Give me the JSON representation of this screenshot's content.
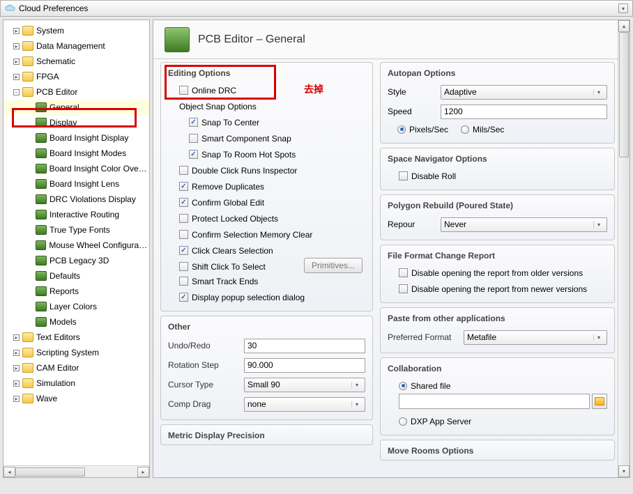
{
  "window": {
    "title": "Cloud Preferences"
  },
  "tree": {
    "top": [
      {
        "label": "System",
        "type": "fold"
      },
      {
        "label": "Data Management",
        "type": "fold"
      },
      {
        "label": "Schematic",
        "type": "fold"
      },
      {
        "label": "FPGA",
        "type": "fold"
      }
    ],
    "pcb_label": "PCB Editor",
    "pcb_children": [
      "General",
      "Display",
      "Board Insight Display",
      "Board Insight Modes",
      "Board Insight Color Overrid",
      "Board Insight Lens",
      "DRC Violations Display",
      "Interactive Routing",
      "True Type Fonts",
      "Mouse Wheel Configuration",
      "PCB Legacy 3D",
      "Defaults",
      "Reports",
      "Layer Colors",
      "Models"
    ],
    "bottom": [
      "Text Editors",
      "Scripting System",
      "CAM Editor",
      "Simulation",
      "Wave"
    ]
  },
  "page": {
    "title": "PCB Editor – General"
  },
  "annotation": "去掉",
  "editing": {
    "heading": "Editing Options",
    "online_drc": "Online DRC",
    "osnap_head": "Object Snap Options",
    "snap_center": "Snap To Center",
    "smart_snap": "Smart Component Snap",
    "snap_room": "Snap To Room Hot Spots",
    "dbl_click": "Double Click Runs Inspector",
    "rem_dup": "Remove Duplicates",
    "conf_global": "Confirm Global Edit",
    "protect_lock": "Protect Locked Objects",
    "conf_mem": "Confirm Selection Memory Clear",
    "click_clears": "Click Clears Selection",
    "shift_click": "Shift Click To Select",
    "smart_track": "Smart Track Ends",
    "popup_sel": "Display popup selection dialog",
    "primitives_btn": "Primitives..."
  },
  "other": {
    "heading": "Other",
    "undo_label": "Undo/Redo",
    "undo": "30",
    "rot_label": "Rotation Step",
    "rot": "90.000",
    "cursor_label": "Cursor Type",
    "cursor": "Small 90",
    "drag_label": "Comp Drag",
    "drag": "none"
  },
  "metric": {
    "heading": "Metric Display Precision"
  },
  "autopan": {
    "heading": "Autopan Options",
    "style_label": "Style",
    "style": "Adaptive",
    "speed_label": "Speed",
    "speed": "1200",
    "r1": "Pixels/Sec",
    "r2": "Mils/Sec"
  },
  "spacenav": {
    "heading": "Space Navigator Options",
    "disable_roll": "Disable Roll"
  },
  "poly": {
    "heading": "Polygon Rebuild (Poured State)",
    "repour_label": "Repour",
    "repour": "Never"
  },
  "ffcr": {
    "heading": "File Format Change Report",
    "c1": "Disable opening the report from older versions",
    "c2": "Disable opening the report from newer versions"
  },
  "paste": {
    "heading": "Paste from other applications",
    "pf_label": "Preferred Format",
    "pf": "Metafile"
  },
  "collab": {
    "heading": "Collaboration",
    "r1": "Shared file",
    "r2": "DXP App Server"
  },
  "move": {
    "heading": "Move Rooms Options"
  }
}
